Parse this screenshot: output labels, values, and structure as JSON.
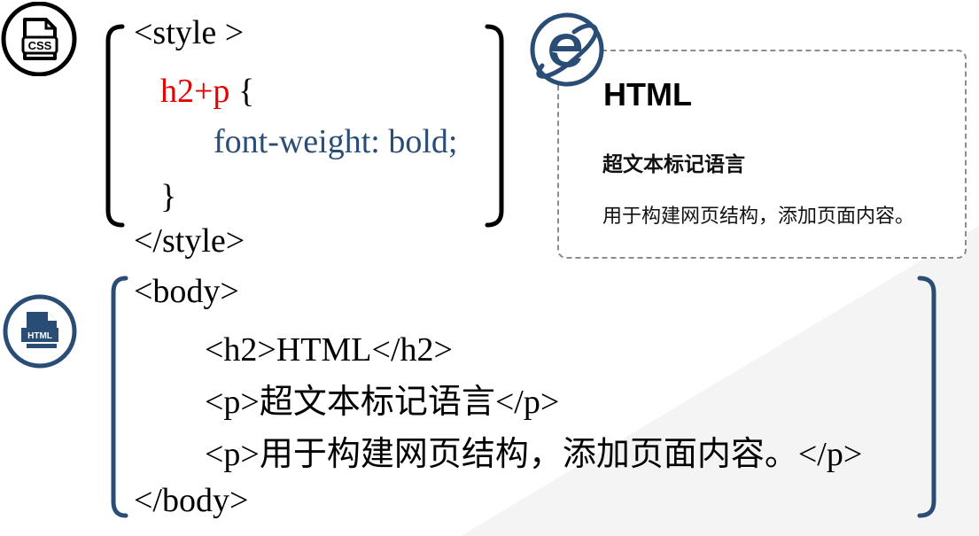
{
  "icons": {
    "css_icon_label": "CSS",
    "html_icon_label": "HTML",
    "browser_icon": "ie-browser-icon"
  },
  "css_code": {
    "style_open": "<style >",
    "selector": "h2+p",
    "brace_open": " {",
    "declaration": "font-weight: bold;",
    "brace_close": "}",
    "style_close": "</style>"
  },
  "html_code": {
    "body_open": "<body>",
    "line_h2": "<h2>HTML</h2>",
    "line_p1": "<p>超文本标记语言</p>",
    "line_p2": "<p>用于构建网页结构，添加页面内容。</p>",
    "body_close": "</body>"
  },
  "preview": {
    "h2": "HTML",
    "p1": "超文本标记语言",
    "p2": "用于构建网页结构，添加页面内容。"
  },
  "colors": {
    "accent_blue": "#2a4d75",
    "selector_red": "#e60000",
    "dashed_border": "#8c8c8c"
  }
}
